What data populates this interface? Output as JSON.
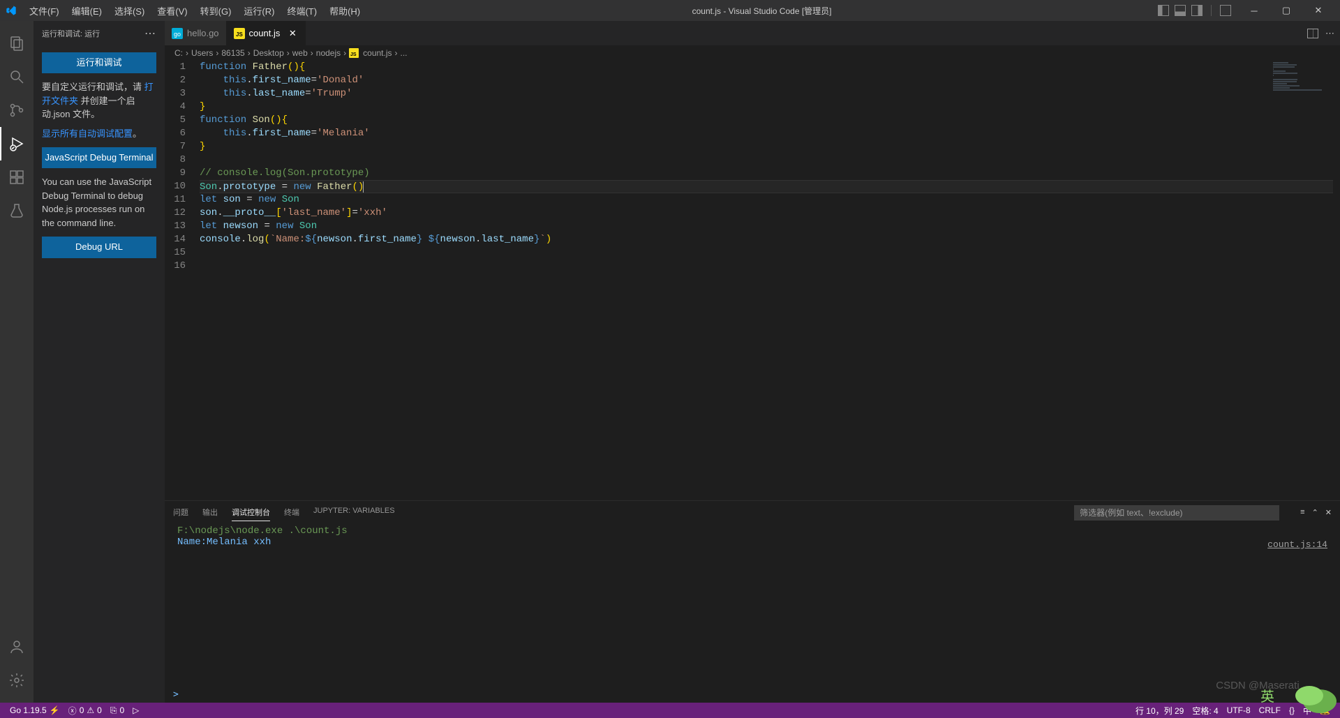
{
  "titlebar": {
    "menu": [
      "文件(F)",
      "编辑(E)",
      "选择(S)",
      "查看(V)",
      "转到(G)",
      "运行(R)",
      "终端(T)",
      "帮助(H)"
    ],
    "title": "count.js - Visual Studio Code [管理员]"
  },
  "activitybar": {
    "items": [
      "files",
      "search",
      "source-control",
      "run-debug",
      "extensions",
      "test"
    ],
    "active": "run-debug"
  },
  "sidebar": {
    "title": "运行和调试: 运行",
    "run_button": "运行和调试",
    "help_text_prefix": "要自定义运行和调试，请",
    "help_link": "打开文件夹",
    "help_text_suffix": " 并创建一个启动.json 文件。",
    "show_config_link": "显示所有自动调试配置",
    "show_config_suffix": "。",
    "js_debug_button": "JavaScript Debug Terminal",
    "js_debug_help": "You can use the JavaScript Debug Terminal to debug Node.js processes run on the command line.",
    "debug_url_button": "Debug URL"
  },
  "tabs": [
    {
      "label": "hello.go",
      "icon": "go",
      "active": false
    },
    {
      "label": "count.js",
      "icon": "js",
      "active": true
    }
  ],
  "breadcrumbs": [
    "C:",
    "Users",
    "86135",
    "Desktop",
    "web",
    "nodejs",
    "count.js",
    "..."
  ],
  "code": {
    "lines": [
      {
        "n": 1,
        "t": "function Father(){",
        "kind": "func-decl",
        "name": "Father"
      },
      {
        "n": 2,
        "t": "    this.first_name='Donald'",
        "kind": "assign"
      },
      {
        "n": 3,
        "t": "    this.last_name='Trump'",
        "kind": "assign"
      },
      {
        "n": 4,
        "t": "}",
        "kind": "close"
      },
      {
        "n": 5,
        "t": "function Son(){",
        "kind": "func-decl",
        "name": "Son"
      },
      {
        "n": 6,
        "t": "    this.first_name='Melania'",
        "kind": "assign"
      },
      {
        "n": 7,
        "t": "}",
        "kind": "close"
      },
      {
        "n": 8,
        "t": "",
        "kind": "blank"
      },
      {
        "n": 9,
        "t": "// console.log(Son.prototype)",
        "kind": "comment"
      },
      {
        "n": 10,
        "t": "Son.prototype = new Father()",
        "kind": "proto",
        "current": true
      },
      {
        "n": 11,
        "t": "let son = new Son",
        "kind": "let"
      },
      {
        "n": 12,
        "t": "son.__proto__['last_name']='xxh'",
        "kind": "proto-assign"
      },
      {
        "n": 13,
        "t": "let newson = new Son",
        "kind": "let"
      },
      {
        "n": 14,
        "t": "console.log(`Name:${newson.first_name} ${newson.last_name}`)",
        "kind": "log"
      },
      {
        "n": 15,
        "t": "",
        "kind": "blank"
      },
      {
        "n": 16,
        "t": "",
        "kind": "blank"
      }
    ]
  },
  "panel": {
    "tabs": [
      "问题",
      "输出",
      "调试控制台",
      "终端",
      "JUPYTER: VARIABLES"
    ],
    "active": "调试控制台",
    "filter_placeholder": "筛选器(例如 text、!exclude)",
    "console_line1": "F:\\nodejs\\node.exe .\\count.js",
    "console_line2": "Name:Melania xxh",
    "console_loc": "count.js:14",
    "prompt": ">"
  },
  "statusbar": {
    "go_version": "Go 1.19.5",
    "errors": "0",
    "warnings": "0",
    "ports": "0",
    "line_col": "行 10，列 29",
    "spaces": "空格: 4",
    "encoding": "UTF-8",
    "eol": "CRLF",
    "lang_icon": "{}",
    "ime": "中",
    "bell_icon": "bell"
  },
  "watermark": "CSDN @Maserati_"
}
